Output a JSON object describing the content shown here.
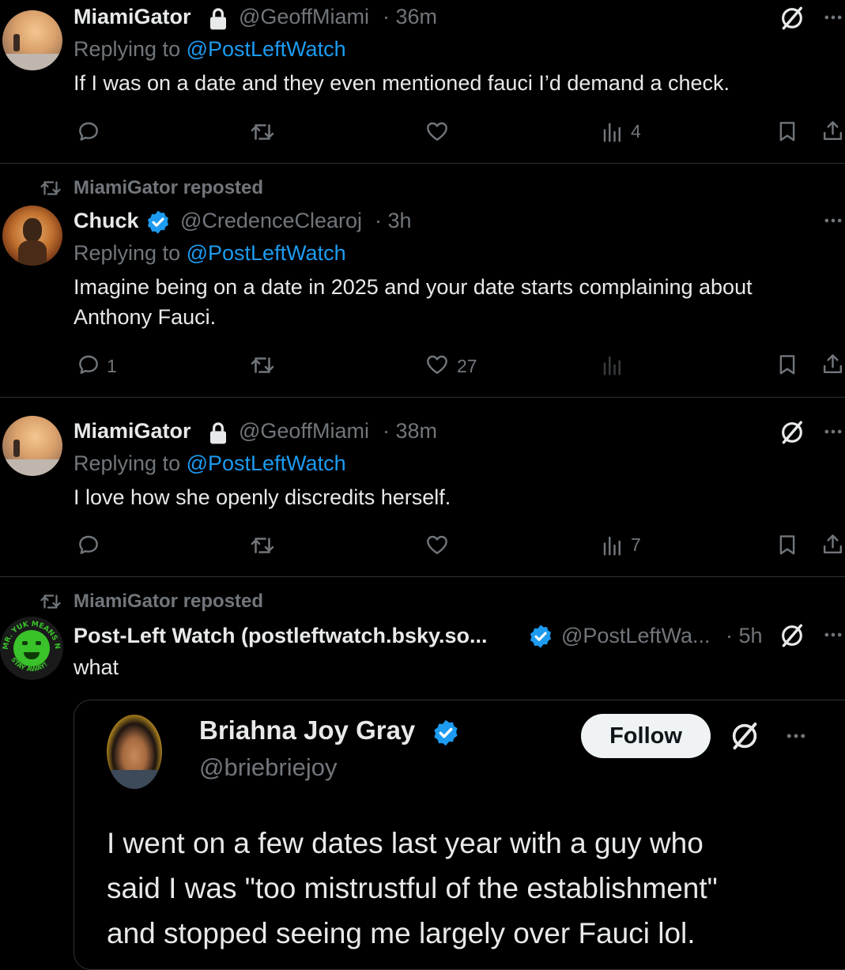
{
  "posts": [
    {
      "author": "MiamiGator",
      "handle": "@GeoffMiami",
      "time": "· 36m",
      "replying_prefix": "Replying to",
      "replying_to": "@PostLeftWatch",
      "text": "If I was on a date and they even mentioned fauci I’d demand a check.",
      "replies": "",
      "reposts": "",
      "likes": "",
      "views": "4"
    },
    {
      "reposted_by": "MiamiGator reposted",
      "author": "Chuck",
      "handle": "@CredenceClearoj",
      "time": "· 3h",
      "replying_prefix": "Replying to",
      "replying_to": "@PostLeftWatch",
      "text_line1": "Imagine being on a date in 2025 and your date starts complaining about",
      "text_line2": "Anthony Fauci.",
      "replies": "1",
      "reposts": "",
      "likes": "27",
      "views": ""
    },
    {
      "author": "MiamiGator",
      "handle": "@GeoffMiami",
      "time": "· 38m",
      "replying_prefix": "Replying to",
      "replying_to": "@PostLeftWatch",
      "text": "I love how she openly discredits herself.",
      "replies": "",
      "reposts": "",
      "likes": "",
      "views": "7"
    },
    {
      "reposted_by": "MiamiGator reposted",
      "author": "Post-Left Watch (postleftwatch.bsky.so...",
      "handle": "@PostLeftWa...",
      "time": "· 5h",
      "text": "what",
      "avatar_text_top": "MR. YUK MEANS NO!",
      "avatar_text_bottom": "STAY AWAY!"
    }
  ],
  "quote": {
    "author": "Briahna Joy Gray",
    "handle": "@briebriejoy",
    "follow_label": "Follow",
    "text_line1": "I went on a few dates last year with a guy who",
    "text_line2": "said I was \"too mistrustful of the establishment\"",
    "text_line3": "and stopped seeing me largely over Fauci lol."
  },
  "colors": {
    "background": "#000000",
    "text": "#e7e9ea",
    "muted": "#71767b",
    "link": "#1d9bf0",
    "verified": "#1d9bf0",
    "divider": "#2f3336"
  },
  "icons": [
    "lock-icon",
    "verified-badge-icon",
    "grok-icon",
    "more-icon",
    "reply-icon",
    "repost-icon",
    "like-icon",
    "views-icon",
    "bookmark-icon",
    "share-icon"
  ]
}
